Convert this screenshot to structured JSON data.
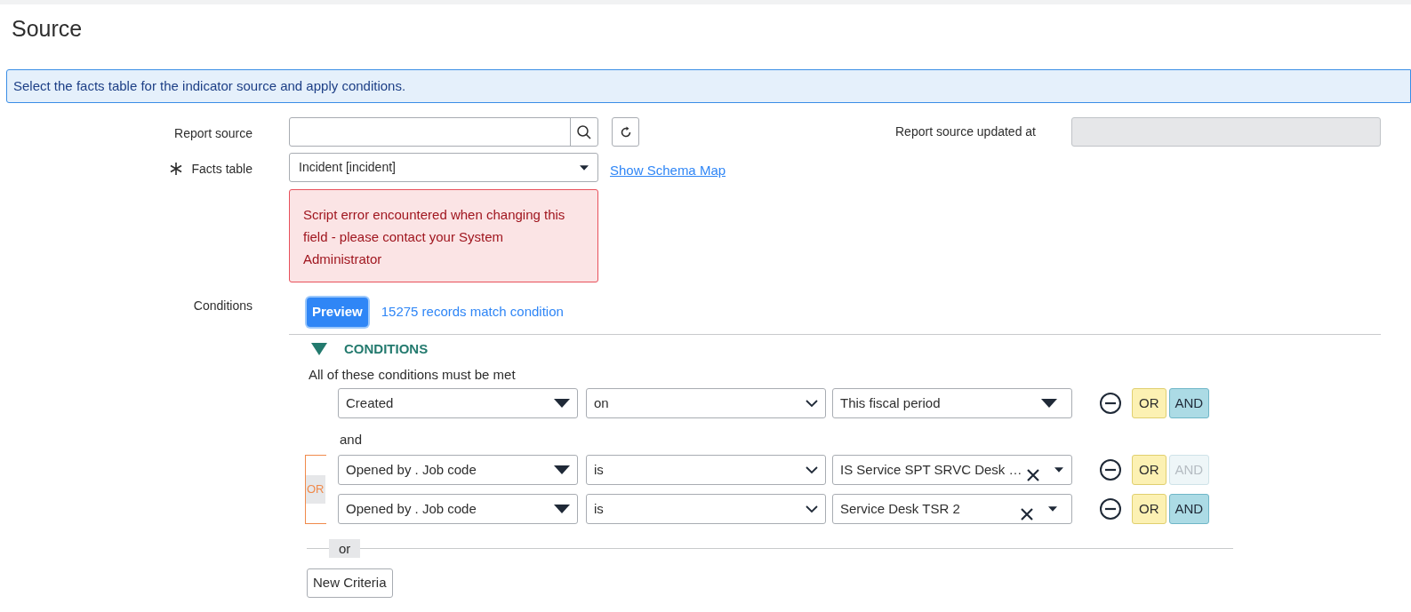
{
  "page_title": "Source",
  "info_message": "Select the facts table for the indicator source and apply conditions.",
  "form": {
    "report_source": {
      "label": "Report source"
    },
    "facts_table": {
      "label": "Facts table",
      "required": true,
      "value": "Incident [incident]",
      "link": "Show Schema Map",
      "error": "Script error encountered when changing this field - please contact your System Administrator"
    },
    "report_source_updated_at": {
      "label": "Report source updated at",
      "disabled": true
    }
  },
  "conditions": {
    "label": "Conditions",
    "preview_button": "Preview",
    "match_count": "15275 records match condition",
    "header": "CONDITIONS",
    "expanded": true,
    "intro": "All of these conditions must be met",
    "groups": [
      {
        "rows": [
          {
            "field": "Created",
            "operator": "on",
            "value": "This fiscal period",
            "kind": "choice",
            "or_button": "OR",
            "and_button": "AND",
            "and_disabled": false
          }
        ]
      },
      {
        "joiner": "and",
        "or_label": "OR",
        "rows": [
          {
            "field": "Opened by . Job code",
            "operator": "is",
            "value": "IS Service SPT SRVC Desk …",
            "kind": "reference",
            "or_button": "OR",
            "and_button": "AND",
            "and_disabled": true
          },
          {
            "field": "Opened by . Job code",
            "operator": "is",
            "value": "Service Desk TSR 2",
            "kind": "reference",
            "or_button": "OR",
            "and_button": "AND",
            "and_disabled": false
          }
        ]
      }
    ],
    "or_separator": "or",
    "new_criteria_button": "New Criteria"
  }
}
